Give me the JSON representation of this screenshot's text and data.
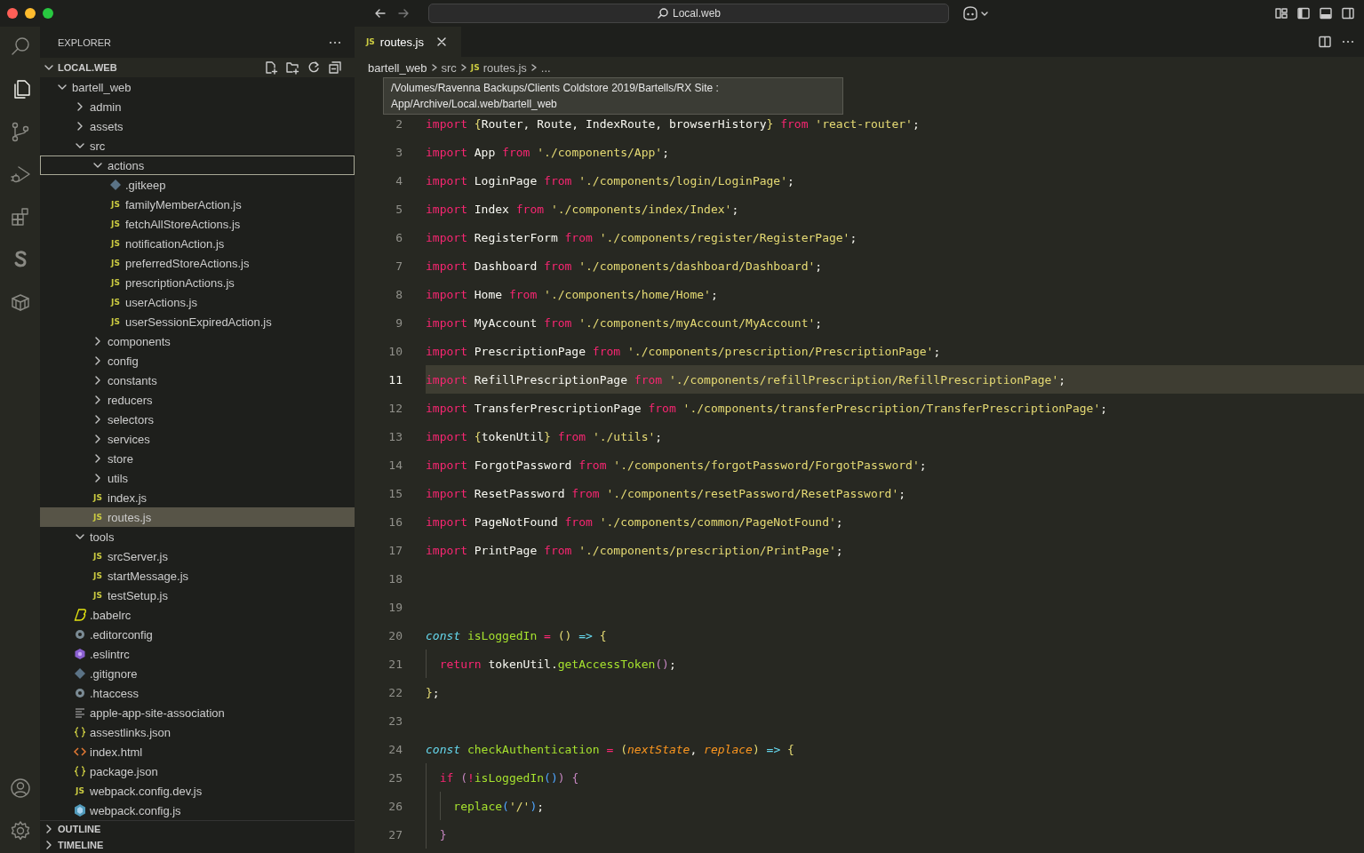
{
  "titlebar": {
    "search": "Local.web"
  },
  "activity_bar": {
    "items": [
      {
        "kind": "search",
        "selected": false
      },
      {
        "kind": "files",
        "selected": true
      },
      {
        "kind": "source-control",
        "selected": false
      },
      {
        "kind": "run-debug",
        "selected": false
      },
      {
        "kind": "extensions",
        "selected": false
      },
      {
        "kind": "s-logo",
        "selected": false
      },
      {
        "kind": "box",
        "selected": false
      }
    ],
    "bottom": [
      {
        "kind": "account"
      },
      {
        "kind": "settings"
      }
    ]
  },
  "explorer": {
    "title": "EXPLORER",
    "section": {
      "label": "LOCAL.WEB",
      "expanded": true
    },
    "tree": [
      {
        "name": "bartell_web",
        "kind": "folder",
        "expanded": true,
        "selected": false,
        "focused": false,
        "children": [
          {
            "name": "admin",
            "kind": "folder",
            "expanded": false,
            "selected": false,
            "focused": false
          },
          {
            "name": "assets",
            "kind": "folder",
            "expanded": false,
            "selected": false,
            "focused": false
          },
          {
            "name": "src",
            "kind": "folder",
            "expanded": true,
            "selected": false,
            "focused": false,
            "children": [
              {
                "name": "actions",
                "kind": "folder",
                "expanded": true,
                "selected": false,
                "focused": true,
                "children": [
                  {
                    "name": ".gitkeep",
                    "kind": "git",
                    "selected": false,
                    "focused": false
                  },
                  {
                    "name": "familyMemberAction.js",
                    "kind": "js",
                    "icon_text": "JS",
                    "selected": false,
                    "focused": false
                  },
                  {
                    "name": "fetchAllStoreActions.js",
                    "kind": "js",
                    "icon_text": "JS",
                    "selected": false,
                    "focused": false
                  },
                  {
                    "name": "notificationAction.js",
                    "kind": "js",
                    "icon_text": "JS",
                    "selected": false,
                    "focused": false
                  },
                  {
                    "name": "preferredStoreActions.js",
                    "kind": "js",
                    "icon_text": "JS",
                    "selected": false,
                    "focused": false
                  },
                  {
                    "name": "prescriptionActions.js",
                    "kind": "js",
                    "icon_text": "JS",
                    "selected": false,
                    "focused": false
                  },
                  {
                    "name": "userActions.js",
                    "kind": "js",
                    "icon_text": "JS",
                    "selected": false,
                    "focused": false
                  },
                  {
                    "name": "userSessionExpiredAction.js",
                    "kind": "js",
                    "icon_text": "JS",
                    "selected": false,
                    "focused": false
                  }
                ]
              },
              {
                "name": "components",
                "kind": "folder",
                "expanded": false,
                "selected": false,
                "focused": false
              },
              {
                "name": "config",
                "kind": "folder",
                "expanded": false,
                "selected": false,
                "focused": false
              },
              {
                "name": "constants",
                "kind": "folder",
                "expanded": false,
                "selected": false,
                "focused": false
              },
              {
                "name": "reducers",
                "kind": "folder",
                "expanded": false,
                "selected": false,
                "focused": false
              },
              {
                "name": "selectors",
                "kind": "folder",
                "expanded": false,
                "selected": false,
                "focused": false
              },
              {
                "name": "services",
                "kind": "folder",
                "expanded": false,
                "selected": false,
                "focused": false
              },
              {
                "name": "store",
                "kind": "folder",
                "expanded": false,
                "selected": false,
                "focused": false
              },
              {
                "name": "utils",
                "kind": "folder",
                "expanded": false,
                "selected": false,
                "focused": false
              },
              {
                "name": "index.js",
                "kind": "js",
                "icon_text": "JS",
                "selected": false,
                "focused": false
              },
              {
                "name": "routes.js",
                "kind": "js",
                "icon_text": "JS",
                "selected": true,
                "focused": false
              }
            ]
          },
          {
            "name": "tools",
            "kind": "folder",
            "expanded": true,
            "selected": false,
            "focused": false,
            "children": [
              {
                "name": "srcServer.js",
                "kind": "js",
                "icon_text": "JS",
                "selected": false,
                "focused": false
              },
              {
                "name": "startMessage.js",
                "kind": "js",
                "icon_text": "JS",
                "selected": false,
                "focused": false
              },
              {
                "name": "testSetup.js",
                "kind": "js",
                "icon_text": "JS",
                "selected": false,
                "focused": false
              }
            ]
          },
          {
            "name": ".babelrc",
            "kind": "babel",
            "selected": false,
            "focused": false
          },
          {
            "name": ".editorconfig",
            "kind": "config",
            "selected": false,
            "focused": false
          },
          {
            "name": ".eslintrc",
            "kind": "eslint",
            "selected": false,
            "focused": false
          },
          {
            "name": ".gitignore",
            "kind": "git",
            "selected": false,
            "focused": false
          },
          {
            "name": ".htaccess",
            "kind": "config",
            "selected": false,
            "focused": false
          },
          {
            "name": "apple-app-site-association",
            "kind": "text",
            "selected": false,
            "focused": false
          },
          {
            "name": "assestlinks.json",
            "kind": "json",
            "selected": false,
            "focused": false
          },
          {
            "name": "index.html",
            "kind": "html",
            "selected": false,
            "focused": false
          },
          {
            "name": "package.json",
            "kind": "json",
            "selected": false,
            "focused": false
          },
          {
            "name": "webpack.config.dev.js",
            "kind": "js",
            "icon_text": "JS",
            "selected": false,
            "focused": false
          },
          {
            "name": "webpack.config.js",
            "kind": "webpack",
            "selected": false,
            "focused": false
          }
        ]
      }
    ],
    "sections": [
      {
        "label": "OUTLINE",
        "expanded": false
      },
      {
        "label": "TIMELINE",
        "expanded": false
      }
    ]
  },
  "editor": {
    "tabs": [
      {
        "label": "routes.js",
        "icon_text": "JS",
        "selected": true
      }
    ],
    "breadcrumb": [
      {
        "label": "bartell_web"
      },
      {
        "label": "src"
      },
      {
        "label": "routes.js",
        "icon_text": "JS"
      },
      {
        "label": "..."
      }
    ],
    "tooltip": [
      "/Volumes/Ravenna Backups/Clients Coldstore 2019/Bartells/RX Site :",
      "App/Archive/Local.web/bartell_web"
    ],
    "lines": [
      {
        "number": "2",
        "current": false,
        "tokens": [
          {
            "kind": "keyword",
            "text": "import "
          },
          {
            "kind": "brace",
            "text": "{"
          },
          {
            "kind": "plain",
            "text": "Router, Route, IndexRoute, browserHistory"
          },
          {
            "kind": "brace",
            "text": "}"
          },
          {
            "kind": "keyword",
            "text": " from "
          },
          {
            "kind": "string",
            "text": "'react-router'"
          },
          {
            "kind": "plain",
            "text": ";"
          }
        ]
      },
      {
        "number": "3",
        "current": false,
        "tokens": [
          {
            "kind": "keyword",
            "text": "import "
          },
          {
            "kind": "plain",
            "text": "App"
          },
          {
            "kind": "keyword",
            "text": " from "
          },
          {
            "kind": "string",
            "text": "'./components/App'"
          },
          {
            "kind": "plain",
            "text": ";"
          }
        ]
      },
      {
        "number": "4",
        "current": false,
        "tokens": [
          {
            "kind": "keyword",
            "text": "import "
          },
          {
            "kind": "plain",
            "text": "LoginPage"
          },
          {
            "kind": "keyword",
            "text": " from "
          },
          {
            "kind": "string",
            "text": "'./components/login/LoginPage'"
          },
          {
            "kind": "plain",
            "text": ";"
          }
        ]
      },
      {
        "number": "5",
        "current": false,
        "tokens": [
          {
            "kind": "keyword",
            "text": "import "
          },
          {
            "kind": "plain",
            "text": "Index"
          },
          {
            "kind": "keyword",
            "text": " from "
          },
          {
            "kind": "string",
            "text": "'./components/index/Index'"
          },
          {
            "kind": "plain",
            "text": ";"
          }
        ]
      },
      {
        "number": "6",
        "current": false,
        "tokens": [
          {
            "kind": "keyword",
            "text": "import "
          },
          {
            "kind": "plain",
            "text": "RegisterForm"
          },
          {
            "kind": "keyword",
            "text": " from "
          },
          {
            "kind": "string",
            "text": "'./components/register/RegisterPage'"
          },
          {
            "kind": "plain",
            "text": ";"
          }
        ]
      },
      {
        "number": "7",
        "current": false,
        "tokens": [
          {
            "kind": "keyword",
            "text": "import "
          },
          {
            "kind": "plain",
            "text": "Dashboard"
          },
          {
            "kind": "keyword",
            "text": " from "
          },
          {
            "kind": "string",
            "text": "'./components/dashboard/Dashboard'"
          },
          {
            "kind": "plain",
            "text": ";"
          }
        ]
      },
      {
        "number": "8",
        "current": false,
        "tokens": [
          {
            "kind": "keyword",
            "text": "import "
          },
          {
            "kind": "plain",
            "text": "Home"
          },
          {
            "kind": "keyword",
            "text": " from "
          },
          {
            "kind": "string",
            "text": "'./components/home/Home'"
          },
          {
            "kind": "plain",
            "text": ";"
          }
        ]
      },
      {
        "number": "9",
        "current": false,
        "tokens": [
          {
            "kind": "keyword",
            "text": "import "
          },
          {
            "kind": "plain",
            "text": "MyAccount"
          },
          {
            "kind": "keyword",
            "text": " from "
          },
          {
            "kind": "string",
            "text": "'./components/myAccount/MyAccount'"
          },
          {
            "kind": "plain",
            "text": ";"
          }
        ]
      },
      {
        "number": "10",
        "current": false,
        "tokens": [
          {
            "kind": "keyword",
            "text": "import "
          },
          {
            "kind": "plain",
            "text": "PrescriptionPage"
          },
          {
            "kind": "keyword",
            "text": " from "
          },
          {
            "kind": "string",
            "text": "'./components/prescription/PrescriptionPage'"
          },
          {
            "kind": "plain",
            "text": ";"
          }
        ]
      },
      {
        "number": "11",
        "current": true,
        "tokens": [
          {
            "kind": "keyword",
            "text": "import "
          },
          {
            "kind": "plain",
            "text": "RefillPrescriptionPage"
          },
          {
            "kind": "keyword",
            "text": " from "
          },
          {
            "kind": "string",
            "text": "'./components/refillPrescription/RefillPrescriptionPage'"
          },
          {
            "kind": "plain",
            "text": ";"
          }
        ]
      },
      {
        "number": "12",
        "current": false,
        "tokens": [
          {
            "kind": "keyword",
            "text": "import "
          },
          {
            "kind": "plain",
            "text": "TransferPrescriptionPage"
          },
          {
            "kind": "keyword",
            "text": " from "
          },
          {
            "kind": "string",
            "text": "'./components/transferPrescription/TransferPrescriptionPage'"
          },
          {
            "kind": "plain",
            "text": ";"
          }
        ]
      },
      {
        "number": "13",
        "current": false,
        "tokens": [
          {
            "kind": "keyword",
            "text": "import "
          },
          {
            "kind": "brace",
            "text": "{"
          },
          {
            "kind": "plain",
            "text": "tokenUtil"
          },
          {
            "kind": "brace",
            "text": "}"
          },
          {
            "kind": "keyword",
            "text": " from "
          },
          {
            "kind": "string",
            "text": "'./utils'"
          },
          {
            "kind": "plain",
            "text": ";"
          }
        ]
      },
      {
        "number": "14",
        "current": false,
        "tokens": [
          {
            "kind": "keyword",
            "text": "import "
          },
          {
            "kind": "plain",
            "text": "ForgotPassword"
          },
          {
            "kind": "keyword",
            "text": " from "
          },
          {
            "kind": "string",
            "text": "'./components/forgotPassword/ForgotPassword'"
          },
          {
            "kind": "plain",
            "text": ";"
          }
        ]
      },
      {
        "number": "15",
        "current": false,
        "tokens": [
          {
            "kind": "keyword",
            "text": "import "
          },
          {
            "kind": "plain",
            "text": "ResetPassword"
          },
          {
            "kind": "keyword",
            "text": " from "
          },
          {
            "kind": "string",
            "text": "'./components/resetPassword/ResetPassword'"
          },
          {
            "kind": "plain",
            "text": ";"
          }
        ]
      },
      {
        "number": "16",
        "current": false,
        "tokens": [
          {
            "kind": "keyword",
            "text": "import "
          },
          {
            "kind": "plain",
            "text": "PageNotFound"
          },
          {
            "kind": "keyword",
            "text": " from "
          },
          {
            "kind": "string",
            "text": "'./components/common/PageNotFound'"
          },
          {
            "kind": "plain",
            "text": ";"
          }
        ]
      },
      {
        "number": "17",
        "current": false,
        "tokens": [
          {
            "kind": "keyword",
            "text": "import "
          },
          {
            "kind": "plain",
            "text": "PrintPage"
          },
          {
            "kind": "keyword",
            "text": " from "
          },
          {
            "kind": "string",
            "text": "'./components/prescription/PrintPage'"
          },
          {
            "kind": "plain",
            "text": ";"
          }
        ]
      },
      {
        "number": "18",
        "current": false
      },
      {
        "number": "19",
        "current": false
      },
      {
        "number": "20",
        "current": false,
        "tokens": [
          {
            "kind": "storage",
            "text": "const "
          },
          {
            "kind": "function",
            "text": "isLoggedIn"
          },
          {
            "kind": "keyword",
            "text": " = "
          },
          {
            "kind": "brace",
            "text": "() "
          },
          {
            "kind": "arrow",
            "text": "=> "
          },
          {
            "kind": "brace",
            "text": "{"
          }
        ]
      },
      {
        "number": "21",
        "current": false,
        "tokens": [
          {
            "kind": "keyword",
            "text": "  return"
          },
          {
            "kind": "plain",
            "text": " tokenUtil."
          },
          {
            "kind": "function",
            "text": "getAccessToken"
          },
          {
            "kind": "bracket",
            "text": "()"
          },
          {
            "kind": "plain",
            "text": ";"
          }
        ]
      },
      {
        "number": "22",
        "current": false,
        "tokens": [
          {
            "kind": "brace",
            "text": "}"
          },
          {
            "kind": "plain",
            "text": ";"
          }
        ]
      },
      {
        "number": "23",
        "current": false
      },
      {
        "number": "24",
        "current": false,
        "tokens": [
          {
            "kind": "storage",
            "text": "const "
          },
          {
            "kind": "function",
            "text": "checkAuthentication"
          },
          {
            "kind": "keyword",
            "text": " = "
          },
          {
            "kind": "brace",
            "text": "("
          },
          {
            "kind": "param",
            "text": "nextState"
          },
          {
            "kind": "plain",
            "text": ", "
          },
          {
            "kind": "param",
            "text": "replace"
          },
          {
            "kind": "brace",
            "text": ") "
          },
          {
            "kind": "arrow",
            "text": "=> "
          },
          {
            "kind": "brace",
            "text": "{"
          }
        ]
      },
      {
        "number": "25",
        "current": false,
        "tokens": [
          {
            "kind": "keyword",
            "text": "  if "
          },
          {
            "kind": "bracket",
            "text": "("
          },
          {
            "kind": "keyword",
            "text": "!"
          },
          {
            "kind": "function",
            "text": "isLoggedIn"
          },
          {
            "kind": "call",
            "text": "()"
          },
          {
            "kind": "bracket",
            "text": ") {"
          }
        ]
      },
      {
        "number": "26",
        "current": false,
        "tokens": [
          {
            "kind": "function",
            "text": "    replace"
          },
          {
            "kind": "call",
            "text": "("
          },
          {
            "kind": "string",
            "text": "'/'"
          },
          {
            "kind": "call",
            "text": ")"
          },
          {
            "kind": "plain",
            "text": ";"
          }
        ]
      },
      {
        "number": "27",
        "current": false,
        "tokens": [
          {
            "kind": "bracket",
            "text": "  }"
          }
        ]
      }
    ]
  }
}
